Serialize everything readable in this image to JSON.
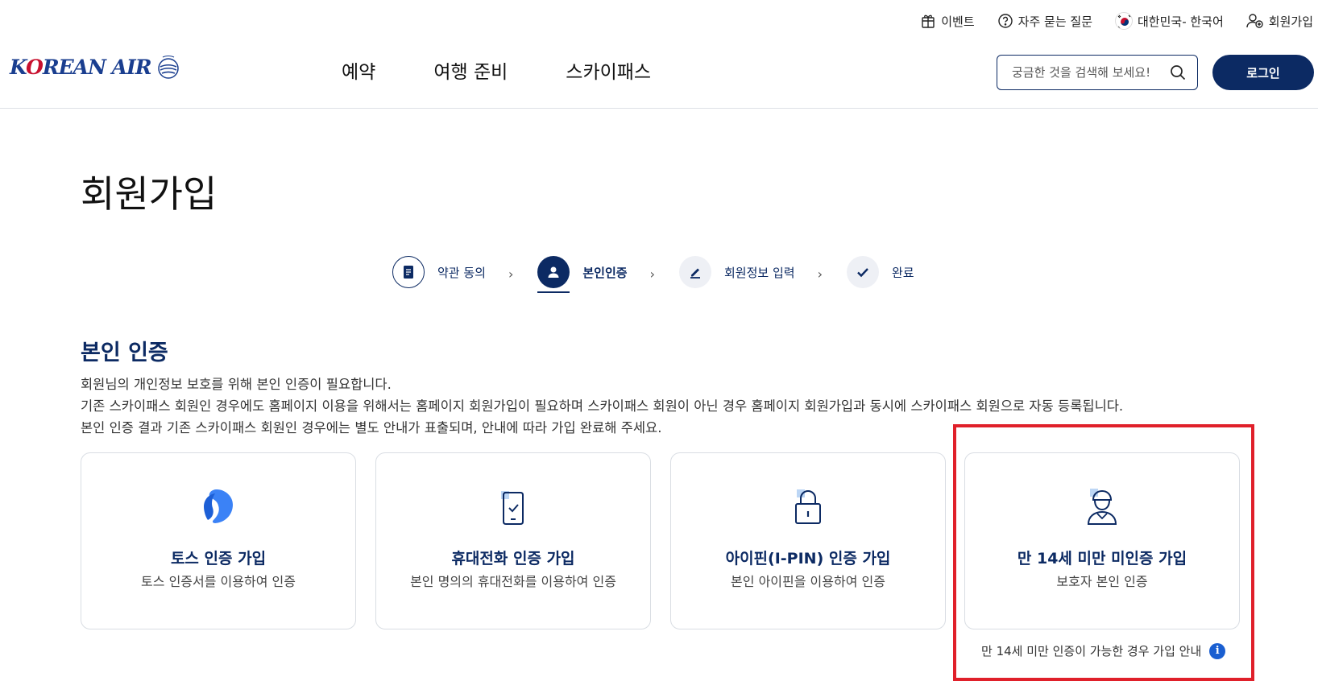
{
  "util_bar": {
    "event": "이벤트",
    "faq": "자주 묻는 질문",
    "locale": "대한민국- 한국어",
    "signup": "회원가입"
  },
  "logo": {
    "text_before": "K",
    "text_o": "O",
    "text_after": "REAN AIR"
  },
  "gnb": {
    "items": [
      "예약",
      "여행 준비",
      "스카이패스"
    ]
  },
  "search": {
    "placeholder": "궁금한 것을 검색해 보세요!"
  },
  "login_label": "로그인",
  "page_title": "회원가입",
  "steps": [
    {
      "label": "약관 동의",
      "state": "done"
    },
    {
      "label": "본인인증",
      "state": "active"
    },
    {
      "label": "회원정보 입력",
      "state": "todo"
    },
    {
      "label": "완료",
      "state": "todo"
    }
  ],
  "step_arrow": "›",
  "section": {
    "title": "본인 인증",
    "desc": [
      "회원님의 개인정보 보호를 위해 본인 인증이 필요합니다.",
      "기존 스카이패스 회원인 경우에도 홈페이지 이용을 위해서는 홈페이지 회원가입이 필요하며 스카이패스 회원이 아닌 경우 홈페이지 회원가입과 동시에 스카이패스 회원으로 자동 등록됩니다.",
      "본인 인증 결과 기존 스카이패스 회원인 경우에는 별도 안내가 표출되며, 안내에 따라 가입 완료해 주세요."
    ]
  },
  "cards": [
    {
      "title": "토스 인증 가입",
      "sub": "토스 인증서를 이용하여 인증",
      "icon": "toss-icon"
    },
    {
      "title": "휴대전화 인증 가입",
      "sub": "본인 명의의 휴대전화를 이용하여 인증",
      "icon": "phone-check-icon"
    },
    {
      "title": "아이핀(I-PIN) 인증 가입",
      "sub": "본인 아이핀을 이용하여 인증",
      "icon": "lock-icon"
    },
    {
      "title": "만 14세 미만 미인증 가입",
      "sub": "보호자 본인 인증",
      "icon": "child-icon"
    }
  ],
  "guide_link": "만 14세 미만 인증이 가능한 경우 가입 안내",
  "info_glyph": "i",
  "colors": {
    "brand_navy": "#0c2a63",
    "highlight_red": "#e0202a",
    "info_blue": "#1a5fd1"
  }
}
